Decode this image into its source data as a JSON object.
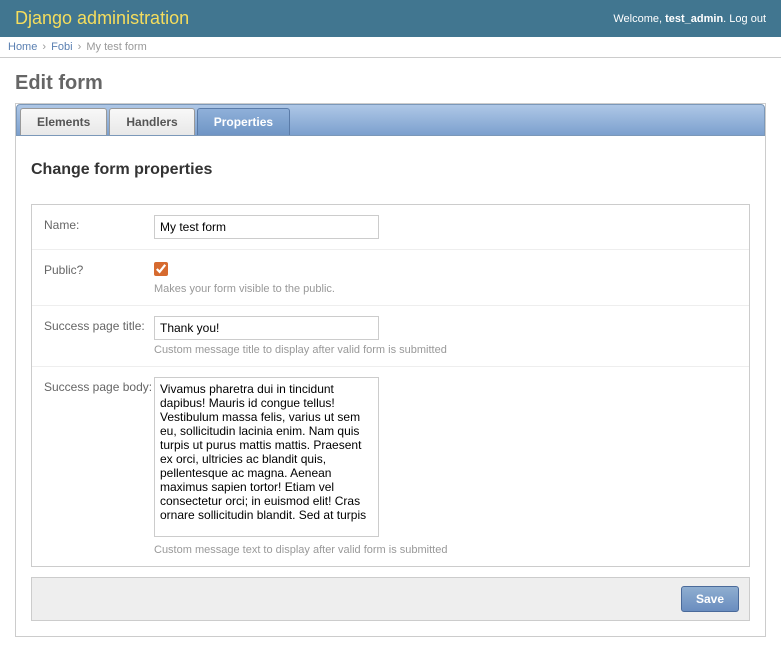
{
  "header": {
    "site_title": "Django administration",
    "welcome_prefix": "Welcome, ",
    "username": "test_admin",
    "logout_label": "Log out"
  },
  "breadcrumbs": {
    "home": "Home",
    "app": "Fobi",
    "current": "My test form"
  },
  "page_title": "Edit form",
  "tabs": {
    "elements": "Elements",
    "handlers": "Handlers",
    "properties": "Properties"
  },
  "form": {
    "heading": "Change form properties",
    "name": {
      "label": "Name:",
      "value": "My test form"
    },
    "public": {
      "label": "Public?",
      "checked": true,
      "help": "Makes your form visible to the public."
    },
    "success_title": {
      "label": "Success page title:",
      "value": "Thank you!",
      "help": "Custom message title to display after valid form is submitted"
    },
    "success_body": {
      "label": "Success page body:",
      "value": "Vivamus pharetra dui in tincidunt dapibus! Mauris id congue tellus! Vestibulum massa felis, varius ut sem eu, sollicitudin lacinia enim. Nam quis turpis ut purus mattis mattis. Praesent ex orci, ultricies ac blandit quis, pellentesque ac magna. Aenean maximus sapien tortor! Etiam vel consectetur orci; in euismod elit! Cras ornare sollicitudin blandit. Sed at turpis",
      "help": "Custom message text to display after valid form is submitted"
    },
    "save_label": "Save"
  }
}
